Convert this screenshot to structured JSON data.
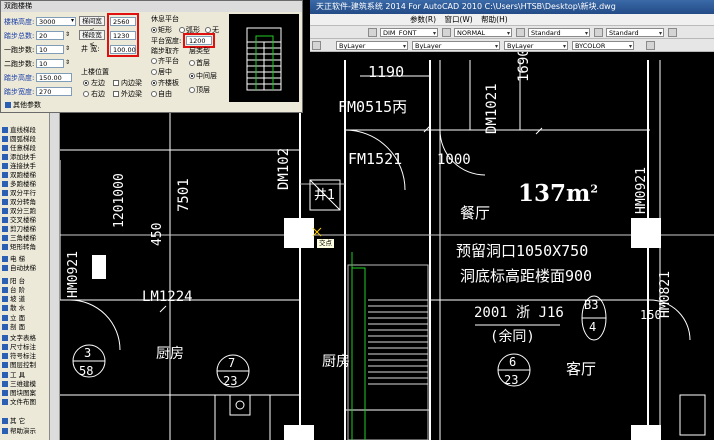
{
  "app": {
    "title": "天正软件-建筑系统 2014  For AutoCAD 2010     C:\\Users\\HTSB\\Desktop\\新块.dwg"
  },
  "menu": [
    "参数(R)",
    "窗口(W)",
    "帮助(H)"
  ],
  "toolbar": {
    "font_style": "DIM_FONT",
    "dim_style": "NORMAL",
    "text_standard": "Standard",
    "table_standard": "Standard",
    "layer": "ByLayer",
    "linetype": "ByLayer",
    "lineweight": "ByLayer",
    "color": "BYCOLOR"
  },
  "dialog": {
    "title": "双跑楼梯",
    "floor_height_label": "楼梯高度:",
    "floor_height_value": "3000",
    "steps_label": "踏步总数:",
    "steps_value": "20",
    "flight1_label": "一跑步数:",
    "flight1_value": "10",
    "flight2_label": "二跑步数:",
    "flight2_value": "10",
    "riser_height_label": "踏步高度:",
    "riser_height_value": "150.00",
    "tread_width_label": "踏步宽度:",
    "tread_width_value": "270",
    "stair_width_button": "梯间宽<",
    "stair_width_value": "2560",
    "flight_width_button": "梯段宽<",
    "flight_width_value": "1230",
    "well_width_label": "井  宽:",
    "well_width_value": "100.00",
    "landing_group": "休息平台",
    "landing_shape": [
      "矩形",
      "弧形",
      "无"
    ],
    "landing_width_label": "平台宽度:",
    "landing_width_value": "1200",
    "step_align_group": "踏步取齐",
    "step_align": [
      "齐平台",
      "居中",
      "齐楼板",
      "自由"
    ],
    "floor_type_group": "层类型",
    "floor_type": [
      "首层",
      "中间层",
      "顶层"
    ],
    "handrail_group": "上楼位置",
    "handrail_pos": [
      "左边",
      "右边"
    ],
    "edge_left": "内边梁",
    "edge_right": "外边梁",
    "more_params": "其他参数"
  },
  "palette": {
    "items": [
      "直线梯段",
      "圆弧梯段",
      "任意梯段",
      "添加扶手",
      "连接扶手",
      "双跑楼梯",
      "多跑楼梯",
      "双分平行",
      "双分转角",
      "双分三跑",
      "交叉楼梯",
      "剪刀楼梯",
      "三角楼梯",
      "矩形转角",
      "电  梯",
      "自动扶梯",
      "阳  台",
      "台  阶",
      "坡  道",
      "散  水",
      "立  面",
      "剖  面",
      "文字表格",
      "尺寸标注",
      "符号标注",
      "图层控制",
      "工  具",
      "三维建模",
      "图块图案",
      "文件布图",
      "其  它",
      "帮助演示"
    ]
  },
  "drawing": {
    "dim_1190": "1190",
    "dim_1690": "1690",
    "door_fm0515": "FM0515丙",
    "dm1021": "DM1021",
    "dm102": "DM102",
    "fm1521": "FM1521",
    "dim_1000": "1000",
    "dim_1201000": "1201000",
    "dim_7501": "7501",
    "dim_450": "450",
    "hm0921_left": "HM0921",
    "hm0921_right": "HM0921",
    "hm0821": "HM0821",
    "well_label": "井1",
    "room_restaurant": "餐厅",
    "area": "137m",
    "area_sup": "2",
    "reserved_hole": "预留洞口1050X750",
    "hole_height": "洞底标高距楼面900",
    "ref_2001": "2001 浙 J16",
    "ref_same": "(余同)",
    "lm1224": "LM1224",
    "kitchen_left": "厨房",
    "kitchen_right": "厨房",
    "living_room": "客厅",
    "bubble_3": "3",
    "bubble_58": "58",
    "bubble_7": "7",
    "bubble_23a": "23",
    "bubble_6": "6",
    "bubble_23b": "23",
    "bubble_b3": "B3",
    "bubble_4": "4",
    "tooltip": "交点",
    "dim_150": "150"
  }
}
